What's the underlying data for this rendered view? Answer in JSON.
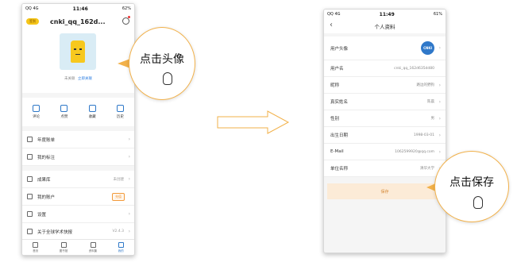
{
  "phone1": {
    "status": {
      "left": "QQ 4G",
      "time": "11:46",
      "right": "62%"
    },
    "header": {
      "tag": "签到",
      "username": "cnki_qq_162d..."
    },
    "association": {
      "text": "未关联",
      "link": "立即关联"
    },
    "actions": [
      {
        "label": "评论",
        "icon": "comment-icon"
      },
      {
        "label": "点赞",
        "icon": "thumbs-up-icon"
      },
      {
        "label": "收藏",
        "icon": "star-icon"
      },
      {
        "label": "历史",
        "icon": "history-icon"
      }
    ],
    "menu1": [
      {
        "label": "年度账单",
        "icon": "flag-icon"
      },
      {
        "label": "我的标注",
        "icon": "annotation-icon"
      }
    ],
    "menu2": [
      {
        "label": "成果库",
        "icon": "library-icon",
        "value": "未创建"
      },
      {
        "label": "我的账户",
        "icon": "account-icon",
        "badge": "充值"
      },
      {
        "label": "设置",
        "icon": "settings-icon"
      },
      {
        "label": "关于全球学术快报",
        "icon": "info-icon",
        "value": "V2.4.3"
      }
    ],
    "tabs": [
      {
        "label": "首页",
        "icon": "home-icon"
      },
      {
        "label": "图书馆",
        "icon": "books-icon"
      },
      {
        "label": "资料集",
        "icon": "collection-icon"
      },
      {
        "label": "我的",
        "icon": "me-icon"
      }
    ]
  },
  "phone2": {
    "status": {
      "left": "QQ 4G",
      "time": "11:49",
      "right": "61%"
    },
    "title": "个人资料",
    "fields": [
      {
        "label": "用户头像",
        "type": "avatar",
        "logo": "CNKI"
      },
      {
        "label": "用户名",
        "value": "cnki_qq_162d635dd80"
      },
      {
        "label": "昵称",
        "value": "路边的野狗"
      },
      {
        "label": "真实姓名",
        "value": "陈晨"
      },
      {
        "label": "性别",
        "value": "男"
      },
      {
        "label": "出生日期",
        "value": "1998-03-01"
      },
      {
        "label": "E-Mail",
        "value": "1062599920@qq.com"
      },
      {
        "label": "单位名称",
        "value": "清华大学"
      }
    ],
    "save_label": "保存"
  },
  "callouts": {
    "avatar": "点击头像",
    "save": "点击保存"
  },
  "colors": {
    "accent": "#2e78c8",
    "callout_border": "#f2b14a",
    "tag": "#f5c518",
    "save_bg": "#fcebd7"
  }
}
